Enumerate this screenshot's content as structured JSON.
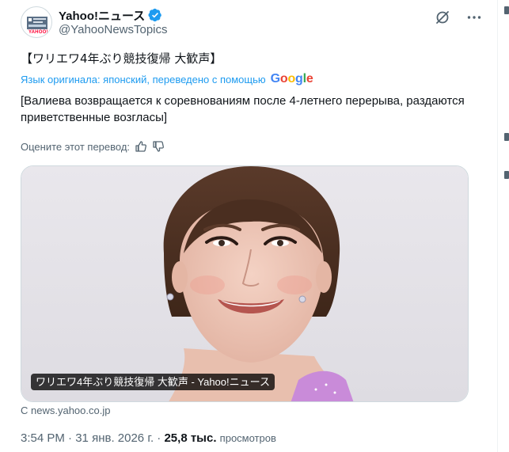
{
  "author": {
    "display_name": "Yahoo!ニュース",
    "handle": "@YahooNewsTopics",
    "avatar_logo_text": "YAHOO!"
  },
  "tweet": {
    "text": "【ワリエワ4年ぶり競技復帰 大歓声】",
    "translation_note": "Язык оригинала: японский, переведено с помощью",
    "translation_provider": "Google",
    "translated_text": "[Валиева возвращается к соревнованиям после 4-летнего перерыва, раздаются приветственные возгласы]",
    "rate_label": "Оцените этот перевод:"
  },
  "media": {
    "caption": "ワリエワ4年ぶり競技復帰 大歓声 - Yahoo!ニュース",
    "source": "С news.yahoo.co.jp"
  },
  "meta": {
    "time": "3:54 PM",
    "separator": " · ",
    "date": "31 янв. 2026 г.",
    "views_count": "25,8 тыс.",
    "views_label": "просмотров"
  },
  "colors": {
    "link_blue": "#1d9bf0",
    "text_primary": "#0f1419",
    "text_secondary": "#536471",
    "border": "#cfd9de"
  },
  "icons": {
    "verified": "verified-badge-icon",
    "grok": "grok-icon",
    "more": "more-dots-icon",
    "thumbs_up": "thumbs-up-icon",
    "thumbs_down": "thumbs-down-icon"
  }
}
